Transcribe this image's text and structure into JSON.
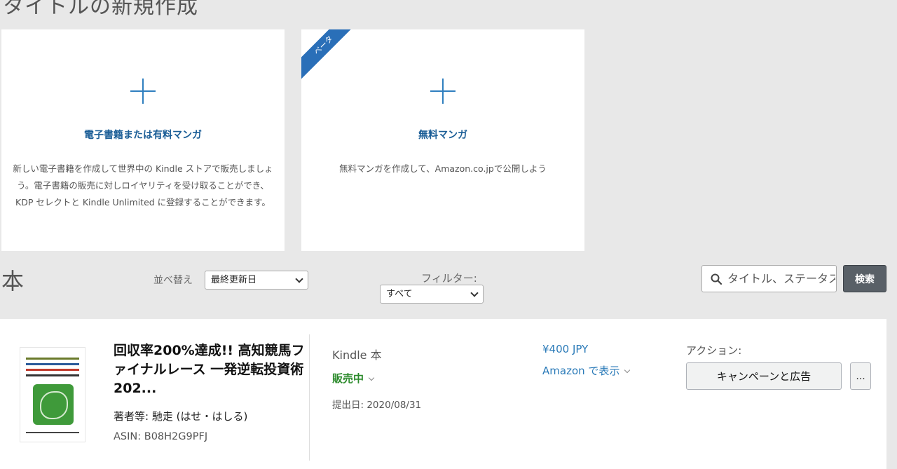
{
  "page": {
    "heading": "タイトルの新規作成"
  },
  "create_cards": {
    "ebook": {
      "title": "電子書籍または有料マンガ",
      "description": "新しい電子書籍を作成して世界中の Kindle ストアで販売しましょう。電子書籍の販売に対しロイヤリティを受け取ることができ、KDP セレクトと Kindle Unlimited に登録することができます。"
    },
    "manga": {
      "badge": "ベータ",
      "title": "無料マンガ",
      "description": "無料マンガを作成して、Amazon.co.jpで公開しよう"
    }
  },
  "bookshelf": {
    "title": "本",
    "sort": {
      "label": "並べ替え",
      "selected": "最終更新日"
    },
    "filter": {
      "label": "フィルター:",
      "selected": "すべて"
    },
    "search": {
      "placeholder": "タイトル、ステータス",
      "button_label": "検索"
    }
  },
  "books": [
    {
      "title": "回収率200%達成!! 高知競馬ファイナルレース 一発逆転投資術202...",
      "author": "著者等: 馳走 (はせ・はしる)",
      "asin": "ASIN: B08H2G9PFJ",
      "format": "Kindle 本",
      "status": "販売中",
      "submitted": "提出日: 2020/08/31",
      "price": "¥400 JPY",
      "amazon_link": "Amazon で表示",
      "actions_label": "アクション:",
      "campaign_button": "キャンペーンと広告",
      "more_button": "..."
    }
  ],
  "colors": {
    "accent_blue": "#2f7fbf",
    "status_green": "#2b8a2b",
    "search_button": "#596067"
  }
}
